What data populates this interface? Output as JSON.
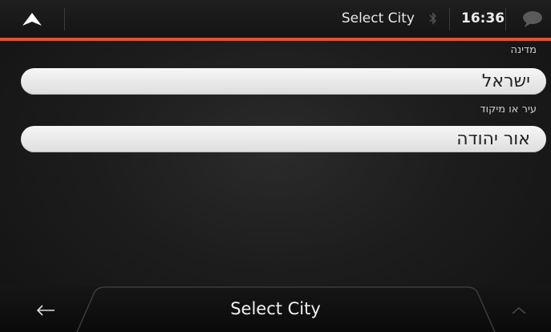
{
  "status_bar": {
    "title": "Select City",
    "time": "16:36",
    "accent_color": "#e3542a"
  },
  "form": {
    "country_label": "מדינה",
    "country_value": "ישראל",
    "city_label": "עיר או מיקוד",
    "city_value": "אור יהודה"
  },
  "bottom_bar": {
    "title": "Select City"
  },
  "icons": {
    "menu": "menu-arrow-up-icon",
    "bluetooth": "bluetooth-icon",
    "messages": "speech-bubble-icon",
    "back": "back-arrow-icon",
    "up": "chevron-up-icon"
  }
}
